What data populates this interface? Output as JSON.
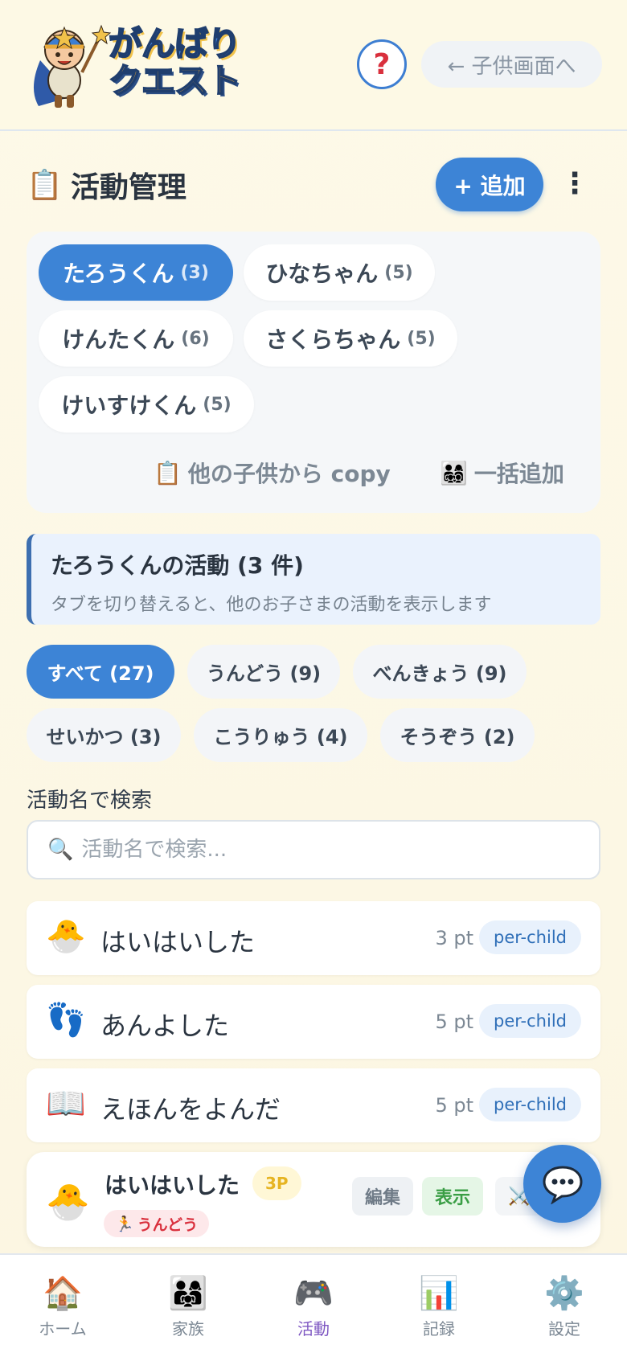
{
  "header": {
    "logo_line1": "がんばり",
    "logo_line2": "クエスト",
    "help_icon": "question-mark-icon",
    "child_view_label": "← 子供画面へ"
  },
  "page": {
    "title_icon": "📋",
    "title": "活動管理",
    "add_label": "+ 追加",
    "more_label": "⋮"
  },
  "children": [
    {
      "name": "たろうくん",
      "count": "(3)",
      "active": true
    },
    {
      "name": "ひなちゃん",
      "count": "(5)",
      "active": false
    },
    {
      "name": "けんたくん",
      "count": "(6)",
      "active": false
    },
    {
      "name": "さくらちゃん",
      "count": "(5)",
      "active": false
    },
    {
      "name": "けいすけくん",
      "count": "(5)",
      "active": false
    }
  ],
  "panel_actions": {
    "copy_icon": "📋",
    "copy_label": "他の子供から copy",
    "bulk_icon": "👨‍👩‍👧‍👦",
    "bulk_label": "一括追加"
  },
  "info": {
    "title": "たろうくんの活動 (3 件)",
    "subtitle": "タブを切り替えると、他のお子さまの活動を表示します"
  },
  "categories": [
    {
      "label": "すべて (27)",
      "active": true
    },
    {
      "label": "うんどう (9)",
      "active": false
    },
    {
      "label": "べんきょう (9)",
      "active": false
    },
    {
      "label": "せいかつ (3)",
      "active": false
    },
    {
      "label": "こうりゅう (4)",
      "active": false
    },
    {
      "label": "そうぞう (2)",
      "active": false
    }
  ],
  "search": {
    "label": "活動名で検索",
    "icon": "🔍",
    "placeholder": "活動名で検索..."
  },
  "activities": [
    {
      "icon": "🐣",
      "name": "はいはいした",
      "points": "3 pt",
      "badge": "per-child"
    },
    {
      "icon": "👣",
      "name": "あんよした",
      "points": "5 pt",
      "badge": "per-child"
    },
    {
      "icon": "📖",
      "name": "えほんをよんだ",
      "points": "5 pt",
      "badge": "per-child"
    }
  ],
  "card": {
    "icon": "🐣",
    "name": "はいはいした",
    "points": "3P",
    "category_icon": "🏃",
    "category": "うんどう",
    "edit_label": "編集",
    "show_label": "表示",
    "archive_icon": "⚔️"
  },
  "nav": [
    {
      "icon": "🏠",
      "label": "ホーム",
      "active": false
    },
    {
      "icon": "👨‍👩‍👧",
      "label": "家族",
      "active": false
    },
    {
      "icon": "🎮",
      "label": "活動",
      "active": true
    },
    {
      "icon": "📊",
      "label": "記録",
      "active": false
    },
    {
      "icon": "⚙️",
      "label": "設定",
      "active": false
    }
  ],
  "colors": {
    "primary": "#3d84d6",
    "background": "#fdf9e5",
    "accent_purple": "#7e57c2",
    "danger_red": "#d9303d",
    "success_green": "#3a9e45"
  }
}
